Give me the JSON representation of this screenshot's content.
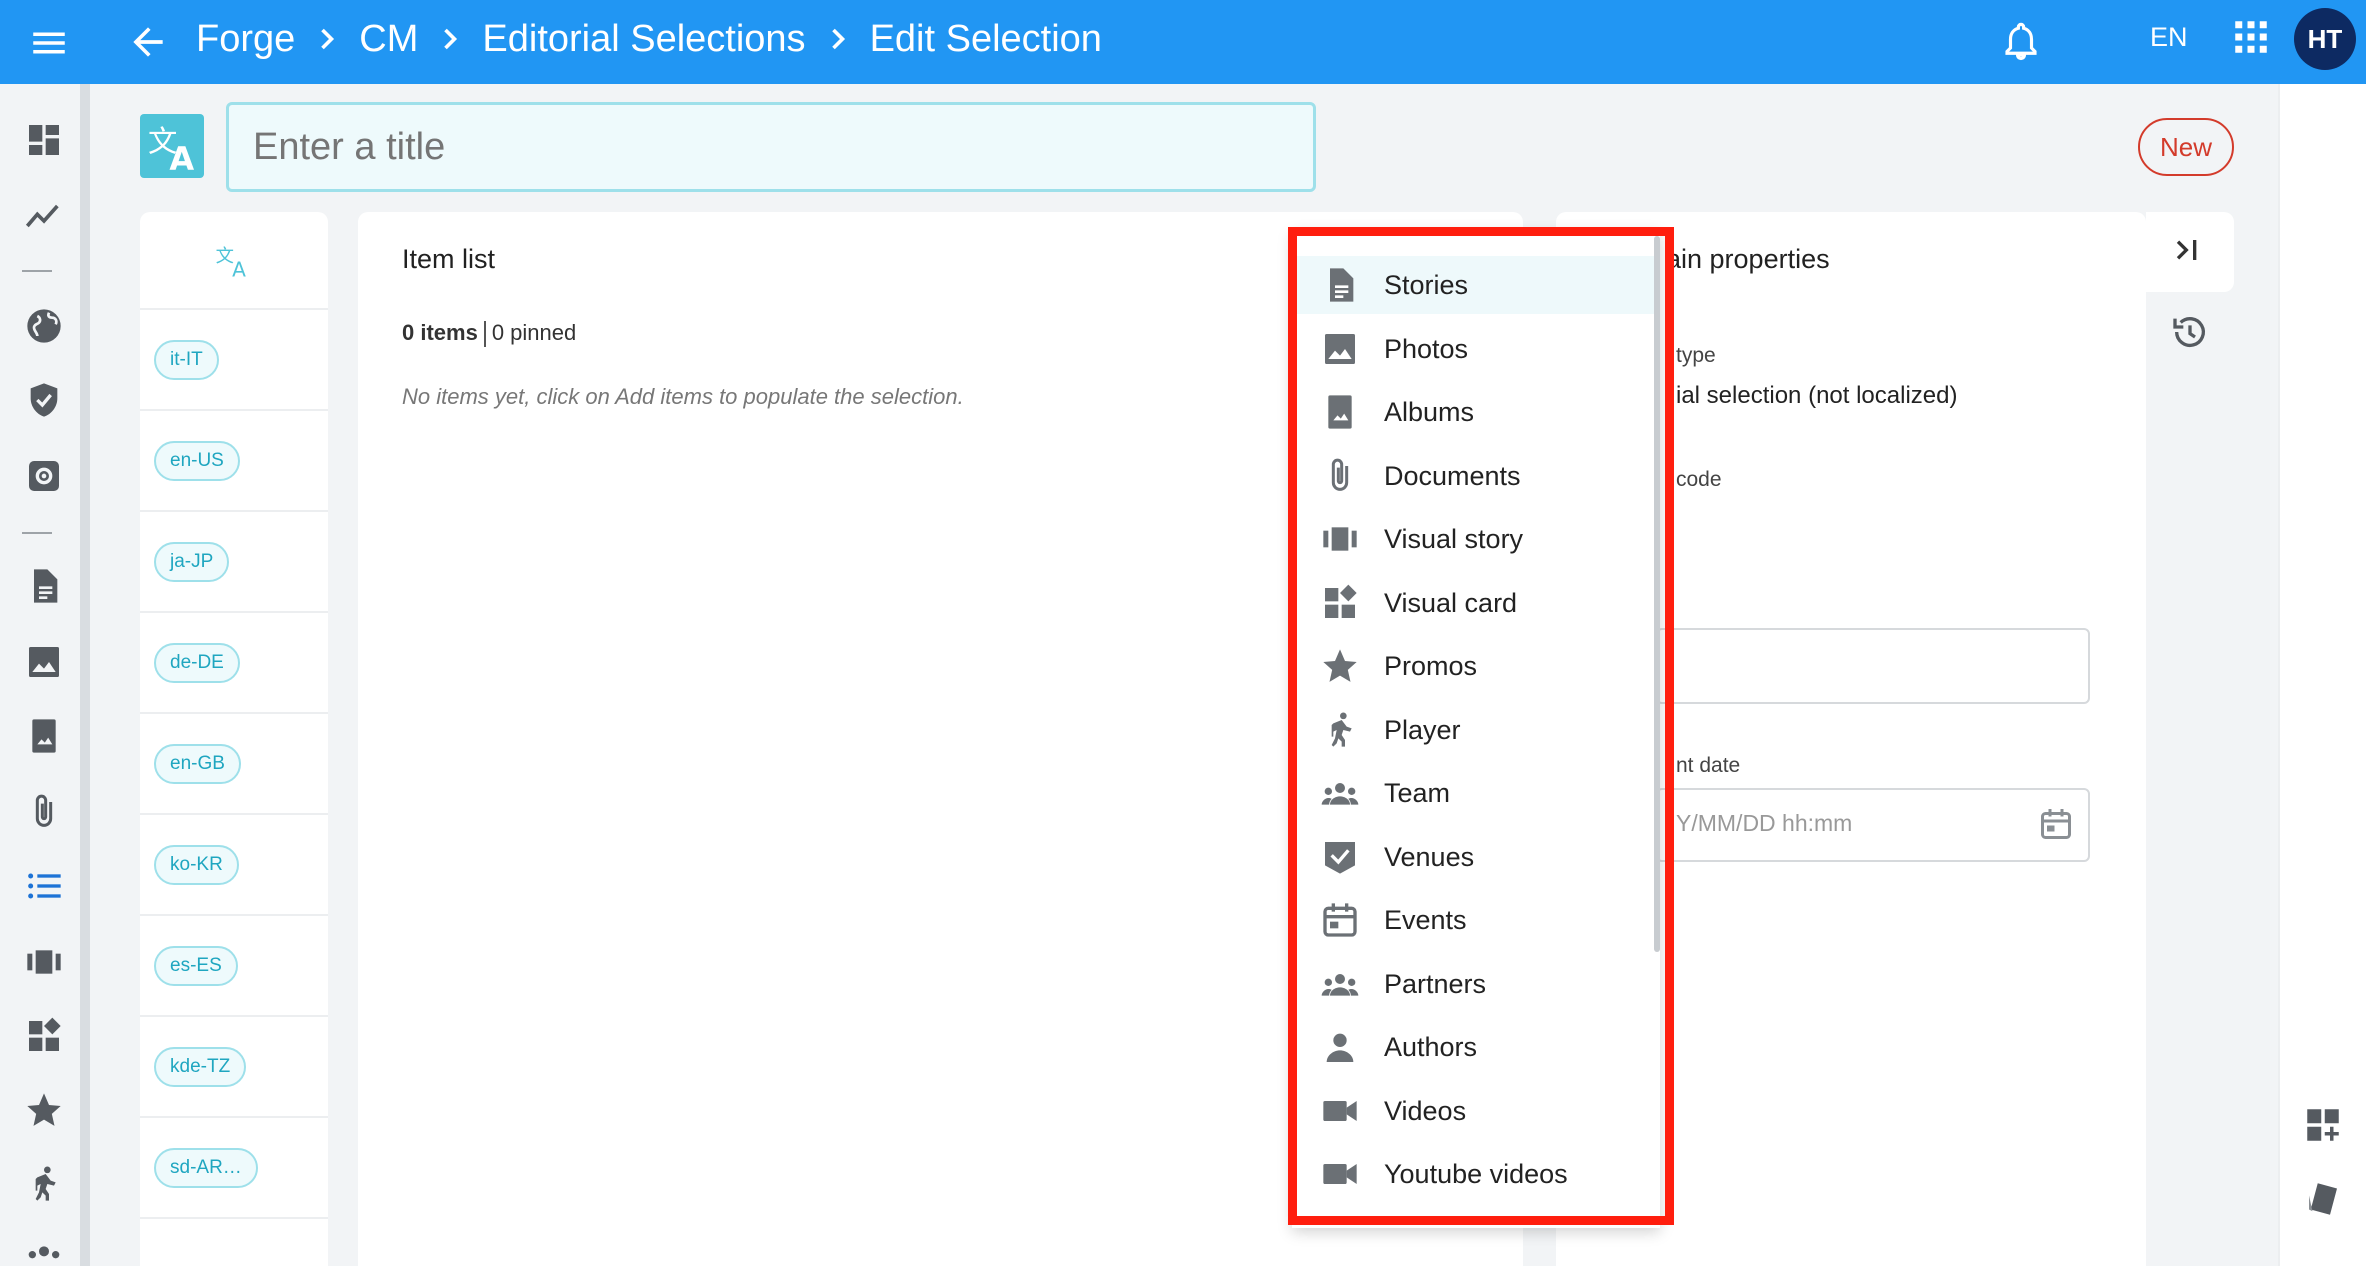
{
  "topbar": {
    "crumbs": [
      "Forge",
      "CM",
      "Editorial Selections",
      "Edit Selection"
    ],
    "lang": "EN",
    "avatar": "HT"
  },
  "title_input": {
    "placeholder": "Enter a title"
  },
  "status_chip": "New",
  "locales": [
    "it-IT",
    "en-US",
    "ja-JP",
    "de-DE",
    "en-GB",
    "ko-KR",
    "es-ES",
    "kde-TZ",
    "sd-AR…"
  ],
  "item_list": {
    "title": "Item list",
    "count": "0 items",
    "pinned": "0 pinned",
    "empty": "No items yet, click on Add items to populate the selection."
  },
  "props": {
    "title": "ain properties",
    "type_label": "type",
    "type_value": "ial selection (not localized)",
    "code_label": "code",
    "date_label": "nt date",
    "date_placeholder": "Y/MM/DD hh:mm"
  },
  "dropdown": {
    "items": [
      {
        "label": "Stories",
        "icon": "document-icon"
      },
      {
        "label": "Photos",
        "icon": "image-icon"
      },
      {
        "label": "Albums",
        "icon": "album-icon"
      },
      {
        "label": "Documents",
        "icon": "paperclip-icon"
      },
      {
        "label": "Visual story",
        "icon": "carousel-icon"
      },
      {
        "label": "Visual card",
        "icon": "widgets-icon"
      },
      {
        "label": "Promos",
        "icon": "star-icon"
      },
      {
        "label": "Player",
        "icon": "player-icon"
      },
      {
        "label": "Team",
        "icon": "group-icon"
      },
      {
        "label": "Venues",
        "icon": "venue-icon"
      },
      {
        "label": "Events",
        "icon": "calendar-icon"
      },
      {
        "label": "Partners",
        "icon": "group-icon"
      },
      {
        "label": "Authors",
        "icon": "person-icon"
      },
      {
        "label": "Videos",
        "icon": "video-icon"
      },
      {
        "label": "Youtube videos",
        "icon": "video-icon"
      }
    ]
  },
  "colors": {
    "topbar": "#2196f3",
    "accent": "#4ec3d8",
    "new_chip": "#d33b2b",
    "highlight": "#ff1e0e"
  }
}
